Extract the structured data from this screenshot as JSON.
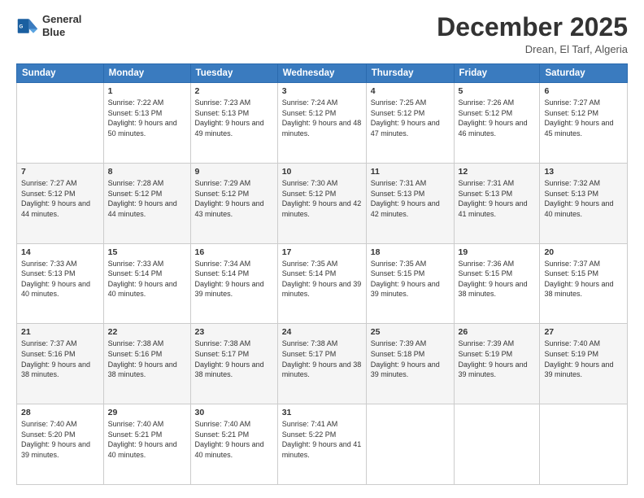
{
  "header": {
    "logo_line1": "General",
    "logo_line2": "Blue",
    "month": "December 2025",
    "location": "Drean, El Tarf, Algeria"
  },
  "days_of_week": [
    "Sunday",
    "Monday",
    "Tuesday",
    "Wednesday",
    "Thursday",
    "Friday",
    "Saturday"
  ],
  "weeks": [
    [
      {
        "day": "",
        "sunrise": "",
        "sunset": "",
        "daylight": ""
      },
      {
        "day": "1",
        "sunrise": "7:22 AM",
        "sunset": "5:13 PM",
        "daylight": "9 hours and 50 minutes."
      },
      {
        "day": "2",
        "sunrise": "7:23 AM",
        "sunset": "5:13 PM",
        "daylight": "9 hours and 49 minutes."
      },
      {
        "day": "3",
        "sunrise": "7:24 AM",
        "sunset": "5:12 PM",
        "daylight": "9 hours and 48 minutes."
      },
      {
        "day": "4",
        "sunrise": "7:25 AM",
        "sunset": "5:12 PM",
        "daylight": "9 hours and 47 minutes."
      },
      {
        "day": "5",
        "sunrise": "7:26 AM",
        "sunset": "5:12 PM",
        "daylight": "9 hours and 46 minutes."
      },
      {
        "day": "6",
        "sunrise": "7:27 AM",
        "sunset": "5:12 PM",
        "daylight": "9 hours and 45 minutes."
      }
    ],
    [
      {
        "day": "7",
        "sunrise": "7:27 AM",
        "sunset": "5:12 PM",
        "daylight": "9 hours and 44 minutes."
      },
      {
        "day": "8",
        "sunrise": "7:28 AM",
        "sunset": "5:12 PM",
        "daylight": "9 hours and 44 minutes."
      },
      {
        "day": "9",
        "sunrise": "7:29 AM",
        "sunset": "5:12 PM",
        "daylight": "9 hours and 43 minutes."
      },
      {
        "day": "10",
        "sunrise": "7:30 AM",
        "sunset": "5:12 PM",
        "daylight": "9 hours and 42 minutes."
      },
      {
        "day": "11",
        "sunrise": "7:31 AM",
        "sunset": "5:13 PM",
        "daylight": "9 hours and 42 minutes."
      },
      {
        "day": "12",
        "sunrise": "7:31 AM",
        "sunset": "5:13 PM",
        "daylight": "9 hours and 41 minutes."
      },
      {
        "day": "13",
        "sunrise": "7:32 AM",
        "sunset": "5:13 PM",
        "daylight": "9 hours and 40 minutes."
      }
    ],
    [
      {
        "day": "14",
        "sunrise": "7:33 AM",
        "sunset": "5:13 PM",
        "daylight": "9 hours and 40 minutes."
      },
      {
        "day": "15",
        "sunrise": "7:33 AM",
        "sunset": "5:14 PM",
        "daylight": "9 hours and 40 minutes."
      },
      {
        "day": "16",
        "sunrise": "7:34 AM",
        "sunset": "5:14 PM",
        "daylight": "9 hours and 39 minutes."
      },
      {
        "day": "17",
        "sunrise": "7:35 AM",
        "sunset": "5:14 PM",
        "daylight": "9 hours and 39 minutes."
      },
      {
        "day": "18",
        "sunrise": "7:35 AM",
        "sunset": "5:15 PM",
        "daylight": "9 hours and 39 minutes."
      },
      {
        "day": "19",
        "sunrise": "7:36 AM",
        "sunset": "5:15 PM",
        "daylight": "9 hours and 38 minutes."
      },
      {
        "day": "20",
        "sunrise": "7:37 AM",
        "sunset": "5:15 PM",
        "daylight": "9 hours and 38 minutes."
      }
    ],
    [
      {
        "day": "21",
        "sunrise": "7:37 AM",
        "sunset": "5:16 PM",
        "daylight": "9 hours and 38 minutes."
      },
      {
        "day": "22",
        "sunrise": "7:38 AM",
        "sunset": "5:16 PM",
        "daylight": "9 hours and 38 minutes."
      },
      {
        "day": "23",
        "sunrise": "7:38 AM",
        "sunset": "5:17 PM",
        "daylight": "9 hours and 38 minutes."
      },
      {
        "day": "24",
        "sunrise": "7:38 AM",
        "sunset": "5:17 PM",
        "daylight": "9 hours and 38 minutes."
      },
      {
        "day": "25",
        "sunrise": "7:39 AM",
        "sunset": "5:18 PM",
        "daylight": "9 hours and 39 minutes."
      },
      {
        "day": "26",
        "sunrise": "7:39 AM",
        "sunset": "5:19 PM",
        "daylight": "9 hours and 39 minutes."
      },
      {
        "day": "27",
        "sunrise": "7:40 AM",
        "sunset": "5:19 PM",
        "daylight": "9 hours and 39 minutes."
      }
    ],
    [
      {
        "day": "28",
        "sunrise": "7:40 AM",
        "sunset": "5:20 PM",
        "daylight": "9 hours and 39 minutes."
      },
      {
        "day": "29",
        "sunrise": "7:40 AM",
        "sunset": "5:21 PM",
        "daylight": "9 hours and 40 minutes."
      },
      {
        "day": "30",
        "sunrise": "7:40 AM",
        "sunset": "5:21 PM",
        "daylight": "9 hours and 40 minutes."
      },
      {
        "day": "31",
        "sunrise": "7:41 AM",
        "sunset": "5:22 PM",
        "daylight": "9 hours and 41 minutes."
      },
      {
        "day": "",
        "sunrise": "",
        "sunset": "",
        "daylight": ""
      },
      {
        "day": "",
        "sunrise": "",
        "sunset": "",
        "daylight": ""
      },
      {
        "day": "",
        "sunrise": "",
        "sunset": "",
        "daylight": ""
      }
    ]
  ],
  "labels": {
    "sunrise_prefix": "Sunrise: ",
    "sunset_prefix": "Sunset: ",
    "daylight_prefix": "Daylight: "
  }
}
